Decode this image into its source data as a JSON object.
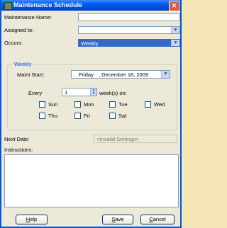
{
  "window": {
    "title": "Maintenance Schedule",
    "close_glyph": "✕"
  },
  "form": {
    "maintenance_name_label": "Maintenance Name:",
    "maintenance_name_value": "",
    "assigned_to_label": "Assigned to:",
    "assigned_to_value": "",
    "occurs_label": "Occurs:",
    "occurs_value": "Weekly"
  },
  "weekly": {
    "group_label": "Weekly",
    "maint_start_label": "Maint Start:",
    "maint_start_day": "Friday",
    "maint_start_date": ", December 18, 2009",
    "every_label": "Every",
    "every_value": "1",
    "weeks_on_label": "week(s) on:",
    "days": [
      "Sun",
      "Mon",
      "Tue",
      "Wed",
      "Thu",
      "Fri",
      "Sat"
    ]
  },
  "next_date": {
    "label": "Next Date:",
    "value": "<Invalid Settings>"
  },
  "instructions": {
    "label": "Instructions:",
    "value": ""
  },
  "buttons": {
    "help_first": "H",
    "help_rest": "elp",
    "save_first": "S",
    "save_rest": "ave",
    "cancel_first": "C",
    "cancel_rest": "ancel"
  }
}
